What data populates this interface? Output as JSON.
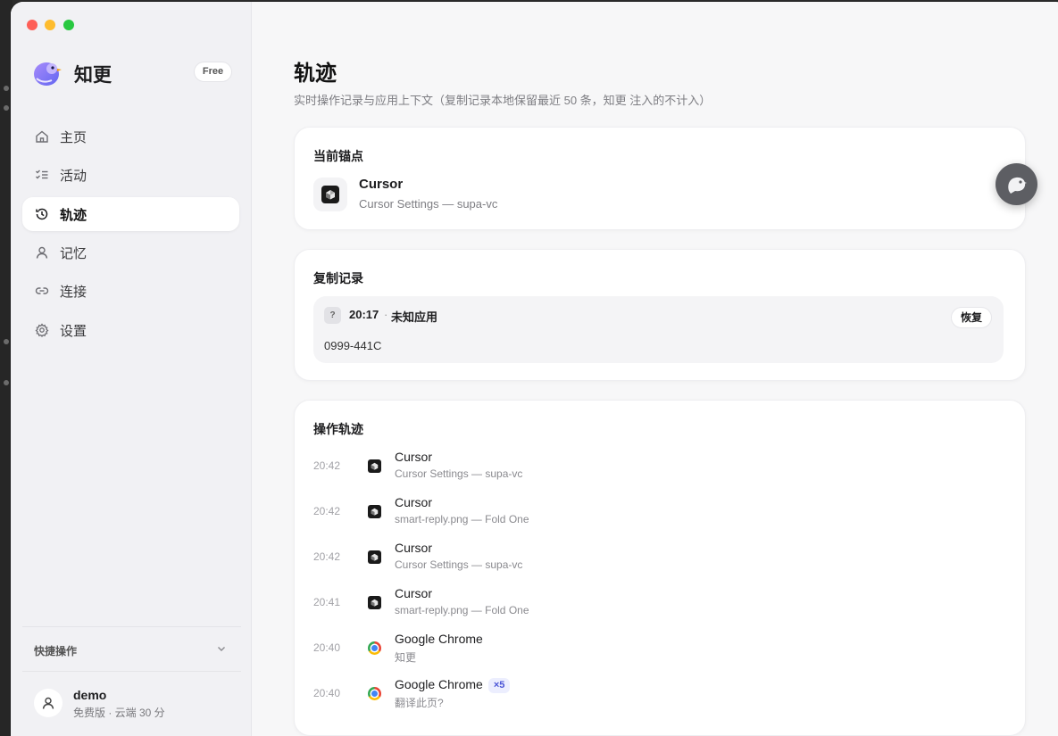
{
  "app": {
    "name": "知更",
    "plan_badge": "Free"
  },
  "sidebar": {
    "items": [
      {
        "label": "主页",
        "icon": "home-icon"
      },
      {
        "label": "活动",
        "icon": "checklist-icon"
      },
      {
        "label": "轨迹",
        "icon": "history-icon",
        "active": true
      },
      {
        "label": "记忆",
        "icon": "user-icon"
      },
      {
        "label": "连接",
        "icon": "link-icon"
      },
      {
        "label": "设置",
        "icon": "gear-icon"
      }
    ],
    "quick_actions_label": "快捷操作",
    "user": {
      "name": "demo",
      "plan": "免费版 · 云端 30 分"
    }
  },
  "page": {
    "title": "轨迹",
    "subtitle": "实时操作记录与应用上下文（复制记录本地保留最近 50 条，知更 注入的不计入）"
  },
  "current_anchor": {
    "title": "当前锚点",
    "app": "Cursor",
    "window": "Cursor Settings — supa-vc"
  },
  "clipboard": {
    "title": "复制记录",
    "items": [
      {
        "icon_glyph": "?",
        "time": "20:17",
        "separator": "·",
        "app": "未知应用",
        "text": "0999-441C",
        "restore_label": "恢复"
      }
    ]
  },
  "trail": {
    "title": "操作轨迹",
    "items": [
      {
        "time": "20:42",
        "app": "Cursor",
        "window": "Cursor Settings — supa-vc",
        "icon": "cursor-app-icon"
      },
      {
        "time": "20:42",
        "app": "Cursor",
        "window": "smart-reply.png — Fold One",
        "icon": "cursor-app-icon"
      },
      {
        "time": "20:42",
        "app": "Cursor",
        "window": "Cursor Settings — supa-vc",
        "icon": "cursor-app-icon"
      },
      {
        "time": "20:41",
        "app": "Cursor",
        "window": "smart-reply.png — Fold One",
        "icon": "cursor-app-icon"
      },
      {
        "time": "20:40",
        "app": "Google Chrome",
        "window": "知更",
        "icon": "chrome-icon"
      },
      {
        "time": "20:40",
        "app": "Google Chrome",
        "count": "×5",
        "window": "翻译此页?",
        "icon": "chrome-icon"
      }
    ]
  },
  "colors": {
    "accent": "#4b55d6",
    "sidebar_bg": "#f1f1f4",
    "window_bg": "#f7f7f8"
  }
}
